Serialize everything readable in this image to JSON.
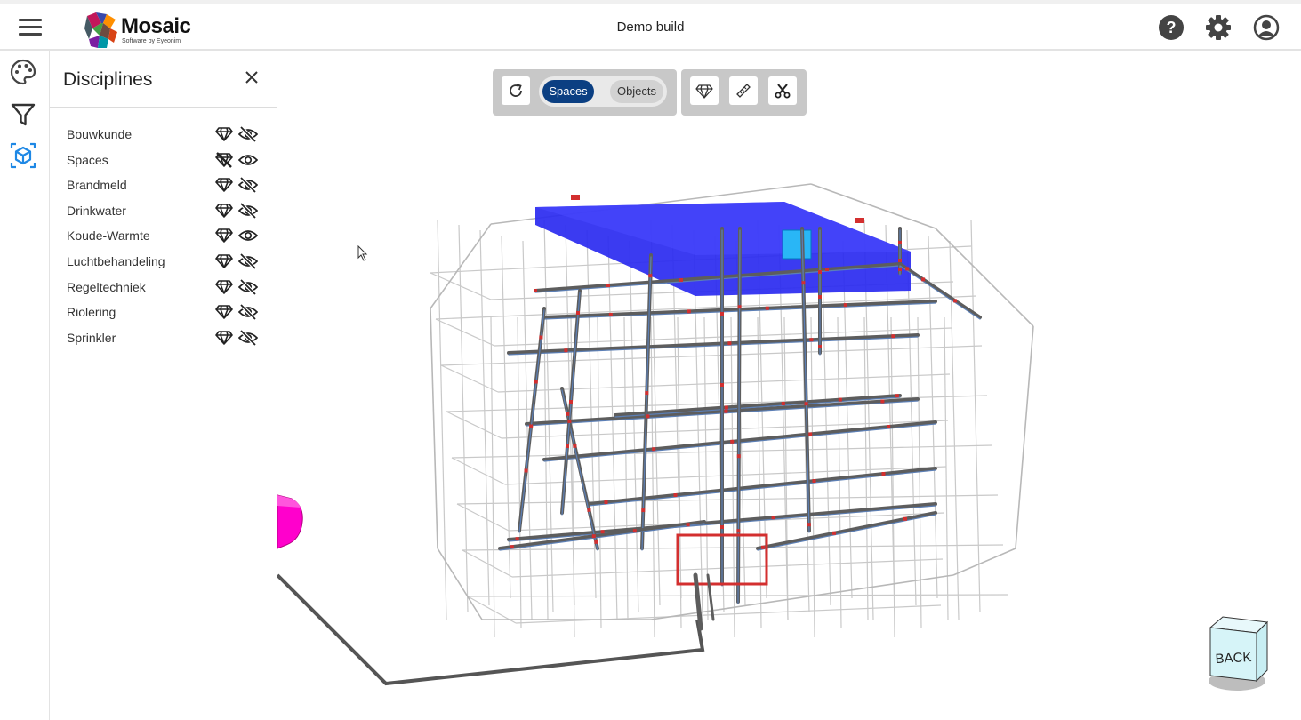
{
  "header": {
    "menu_icon": "hamburger-menu-icon",
    "logo": {
      "name": "Mosaic",
      "tagline": "Software by Eyeonim"
    },
    "title": "Demo build",
    "icons": [
      "help-icon",
      "settings-gear-icon",
      "account-icon"
    ]
  },
  "rail": {
    "items": [
      {
        "icon": "palette-icon",
        "active": false
      },
      {
        "icon": "filter-icon",
        "active": false
      },
      {
        "icon": "cube-disciplines-icon",
        "active": true
      }
    ],
    "active_color": "#1e88e5"
  },
  "panel": {
    "title": "Disciplines",
    "close_icon": "close-icon",
    "items": [
      {
        "label": "Bouwkunde",
        "gem_enabled": true,
        "visible": false
      },
      {
        "label": "Spaces",
        "gem_enabled": false,
        "visible": true
      },
      {
        "label": "Brandmeld",
        "gem_enabled": true,
        "visible": false
      },
      {
        "label": "Drinkwater",
        "gem_enabled": true,
        "visible": false
      },
      {
        "label": "Koude-Warmte",
        "gem_enabled": true,
        "visible": true
      },
      {
        "label": "Luchtbehandeling",
        "gem_enabled": true,
        "visible": false
      },
      {
        "label": "Regeltechniek",
        "gem_enabled": true,
        "visible": false
      },
      {
        "label": "Riolering",
        "gem_enabled": true,
        "visible": false
      },
      {
        "label": "Sprinkler",
        "gem_enabled": true,
        "visible": false
      }
    ]
  },
  "toolbar": {
    "reset_icon": "refresh-icon",
    "toggle": {
      "active": "Spaces",
      "inactive": "Objects"
    },
    "tools": [
      "gem-icon",
      "ruler-measure-icon",
      "scissors-section-icon"
    ]
  },
  "viewport": {
    "navcube_label": "BACK",
    "model_colors": {
      "spaces": "#2a2af0",
      "duct": "#666666",
      "accent": "#d32f2f",
      "highlight": "#29b6f6",
      "magenta": "#ff00cc"
    }
  }
}
